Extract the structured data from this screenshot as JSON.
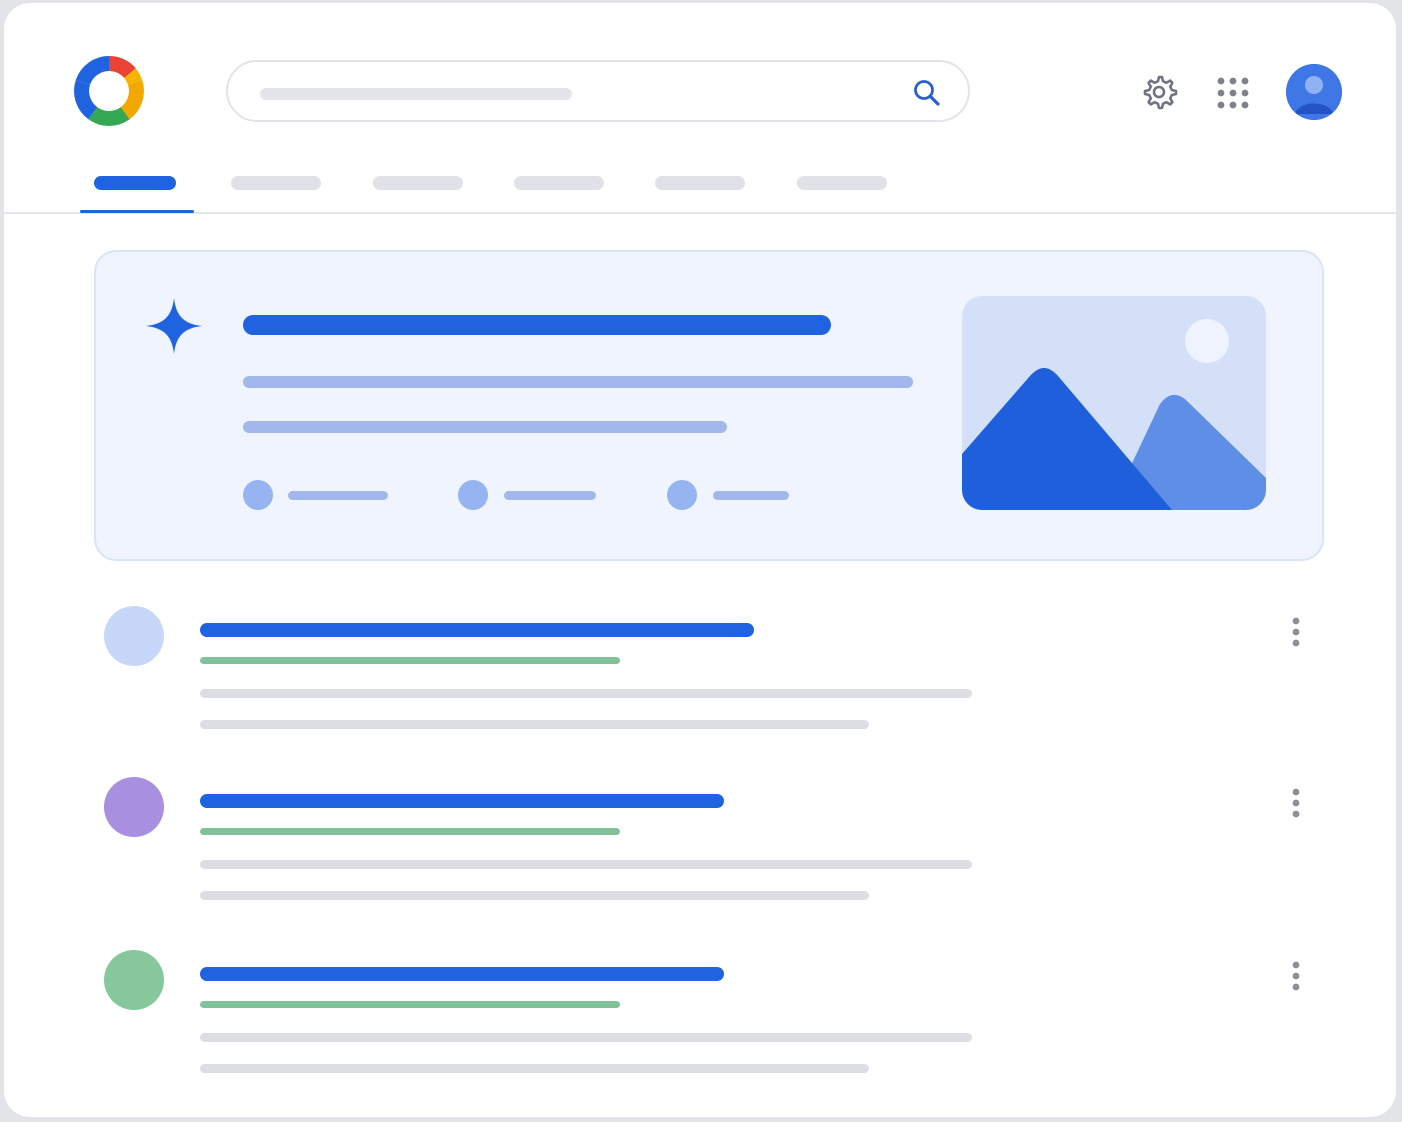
{
  "app": {
    "colors": {
      "accent": "#1f63e0",
      "tab_inactive": "#e1e2e7",
      "url_green": "#82c29b",
      "snippet_gray": "#dddee3",
      "card_bg": "#eff4fe",
      "card_text": "#a2b8ec"
    }
  },
  "header": {
    "logo_icon": "multicolor-ring-logo",
    "search": {
      "value": "",
      "icon": "search-icon"
    },
    "settings_icon": "gear-icon",
    "apps_icon": "apps-grid-icon",
    "account_icon": "avatar-icon"
  },
  "tabs": [
    {
      "label": "",
      "active": true
    },
    {
      "label": "",
      "active": false
    },
    {
      "label": "",
      "active": false
    },
    {
      "label": "",
      "active": false
    },
    {
      "label": "",
      "active": false
    },
    {
      "label": "",
      "active": false
    }
  ],
  "overview": {
    "icon": "sparkle-icon",
    "title": "",
    "lines": [
      "",
      ""
    ],
    "sources": [
      "",
      "",
      ""
    ],
    "image_icon": "landscape-image-icon"
  },
  "results": [
    {
      "avatar_color": "#c6d7fa",
      "title": "",
      "url": "",
      "snippet": [
        "",
        ""
      ]
    },
    {
      "avatar_color": "#a88fdf",
      "title": "",
      "url": "",
      "snippet": [
        "",
        ""
      ]
    },
    {
      "avatar_color": "#86c79b",
      "title": "",
      "url": "",
      "snippet": [
        "",
        ""
      ]
    }
  ]
}
